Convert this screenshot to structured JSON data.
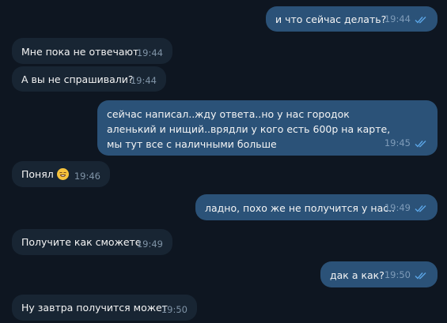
{
  "colors": {
    "background": "#0e1621",
    "incoming_bubble": "#182533",
    "outgoing_bubble": "#2b5278",
    "read_ticks": "#5ba5e6"
  },
  "messages": [
    {
      "direction": "out",
      "text": "и что сейчас делать?",
      "time": "19:44",
      "status_icon": "double-check-icon"
    },
    {
      "direction": "in",
      "text": "Мне пока не отвечают",
      "time": "19:44"
    },
    {
      "direction": "in",
      "text": "А вы не спрашивали?",
      "time": "19:44"
    },
    {
      "direction": "out",
      "text": "сейчас написал..жду ответа..но у нас городок аленький и нищий..врядли у кого есть 600р на карте, мы тут все с наличными больше",
      "time": "19:45",
      "status_icon": "double-check-icon"
    },
    {
      "direction": "in",
      "text": "Понял",
      "emoji": "grinning-face-emoji",
      "time": "19:46"
    },
    {
      "direction": "out",
      "text": "ладно, похо же не получится у нас..",
      "time": "19:49",
      "status_icon": "double-check-icon"
    },
    {
      "direction": "in",
      "text": "Получите как сможете",
      "time": "19:49"
    },
    {
      "direction": "out",
      "text": "дак а как?",
      "time": "19:50",
      "status_icon": "double-check-icon"
    },
    {
      "direction": "in",
      "text": "Ну завтра получится может",
      "time": "19:50"
    }
  ]
}
